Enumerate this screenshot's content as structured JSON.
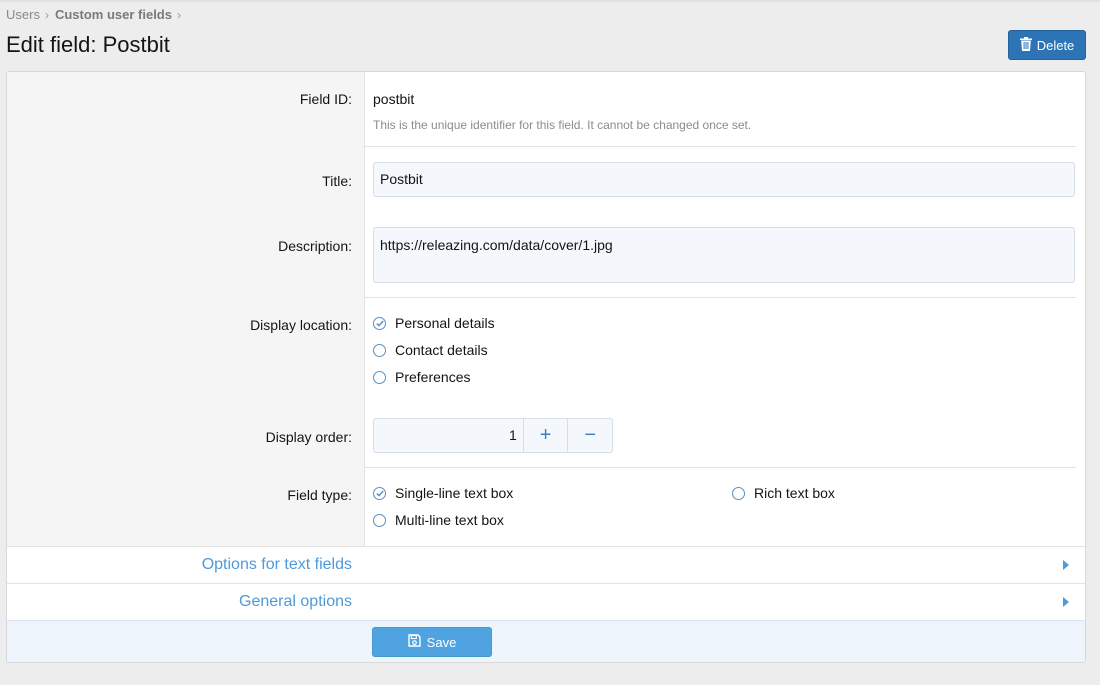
{
  "breadcrumb": {
    "items": [
      "Users",
      "Custom user fields"
    ],
    "separator": "›"
  },
  "page": {
    "title": "Edit field: Postbit"
  },
  "actions": {
    "delete_label": "Delete"
  },
  "fields": {
    "field_id": {
      "label": "Field ID:",
      "value": "postbit",
      "hint": "This is the unique identifier for this field. It cannot be changed once set."
    },
    "title": {
      "label": "Title:",
      "value": "Postbit"
    },
    "description": {
      "label": "Description:",
      "value": "https://releazing.com/data/cover/1.jpg"
    },
    "display_location": {
      "label": "Display location:",
      "options": [
        {
          "label": "Personal details",
          "selected": true
        },
        {
          "label": "Contact details",
          "selected": false
        },
        {
          "label": "Preferences",
          "selected": false
        }
      ]
    },
    "display_order": {
      "label": "Display order:",
      "value": "1",
      "plus": "+",
      "minus": "−"
    },
    "field_type": {
      "label": "Field type:",
      "options": [
        {
          "label": "Single-line text box",
          "selected": true
        },
        {
          "label": "Multi-line text box",
          "selected": false
        },
        {
          "label": "Rich text box",
          "selected": false
        }
      ]
    }
  },
  "sections": [
    {
      "label": "Options for text fields"
    },
    {
      "label": "General options"
    }
  ],
  "footer": {
    "save_label": "Save"
  },
  "colors": {
    "primary": "#2d74b7",
    "link": "#4f9ad8",
    "save": "#4fa3e0",
    "radio": "#5b8fc3"
  }
}
